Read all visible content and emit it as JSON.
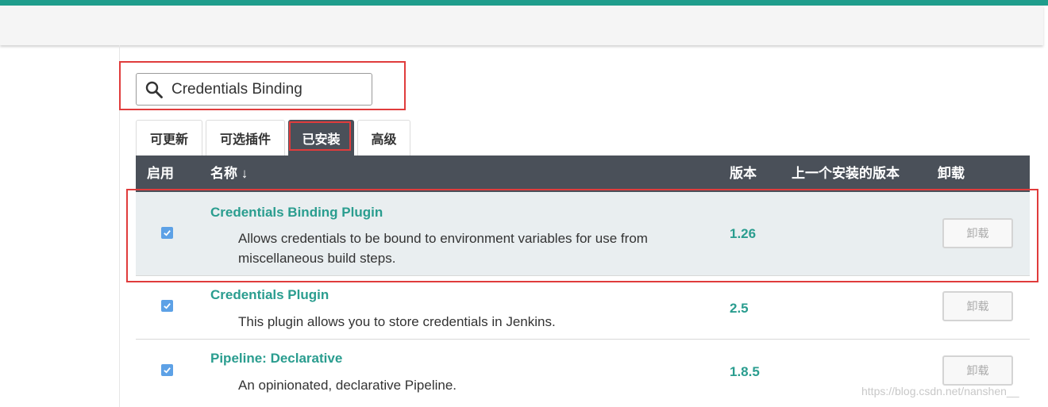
{
  "search": {
    "value": "Credentials Binding"
  },
  "tabs": [
    {
      "label": "可更新"
    },
    {
      "label": "可选插件"
    },
    {
      "label": "已安装",
      "active": true
    },
    {
      "label": "高级"
    }
  ],
  "table": {
    "headers": {
      "enabled": "启用",
      "name": "名称 ↓",
      "version": "版本",
      "previous_version": "上一个安装的版本",
      "uninstall": "卸载"
    },
    "rows": [
      {
        "name": "Credentials Binding Plugin",
        "description": "Allows credentials to be bound to environment variables for use from miscellaneous build steps.",
        "version": "1.26",
        "enabled": true,
        "uninstall_label": "卸载"
      },
      {
        "name": "Credentials Plugin",
        "description": "This plugin allows you to store credentials in Jenkins.",
        "version": "2.5",
        "enabled": true,
        "uninstall_label": "卸载"
      },
      {
        "name": "Pipeline: Declarative",
        "description": "An opinionated, declarative Pipeline.",
        "version": "1.8.5",
        "enabled": true,
        "uninstall_label": "卸载"
      }
    ]
  },
  "watermark": "https://blog.csdn.net/nanshen__",
  "colors": {
    "accent": "#1f9d8c",
    "link": "#2a9d8f",
    "header_bg": "#4a5059",
    "annotation": "#e03c3c",
    "checkbox": "#5da1e6"
  }
}
